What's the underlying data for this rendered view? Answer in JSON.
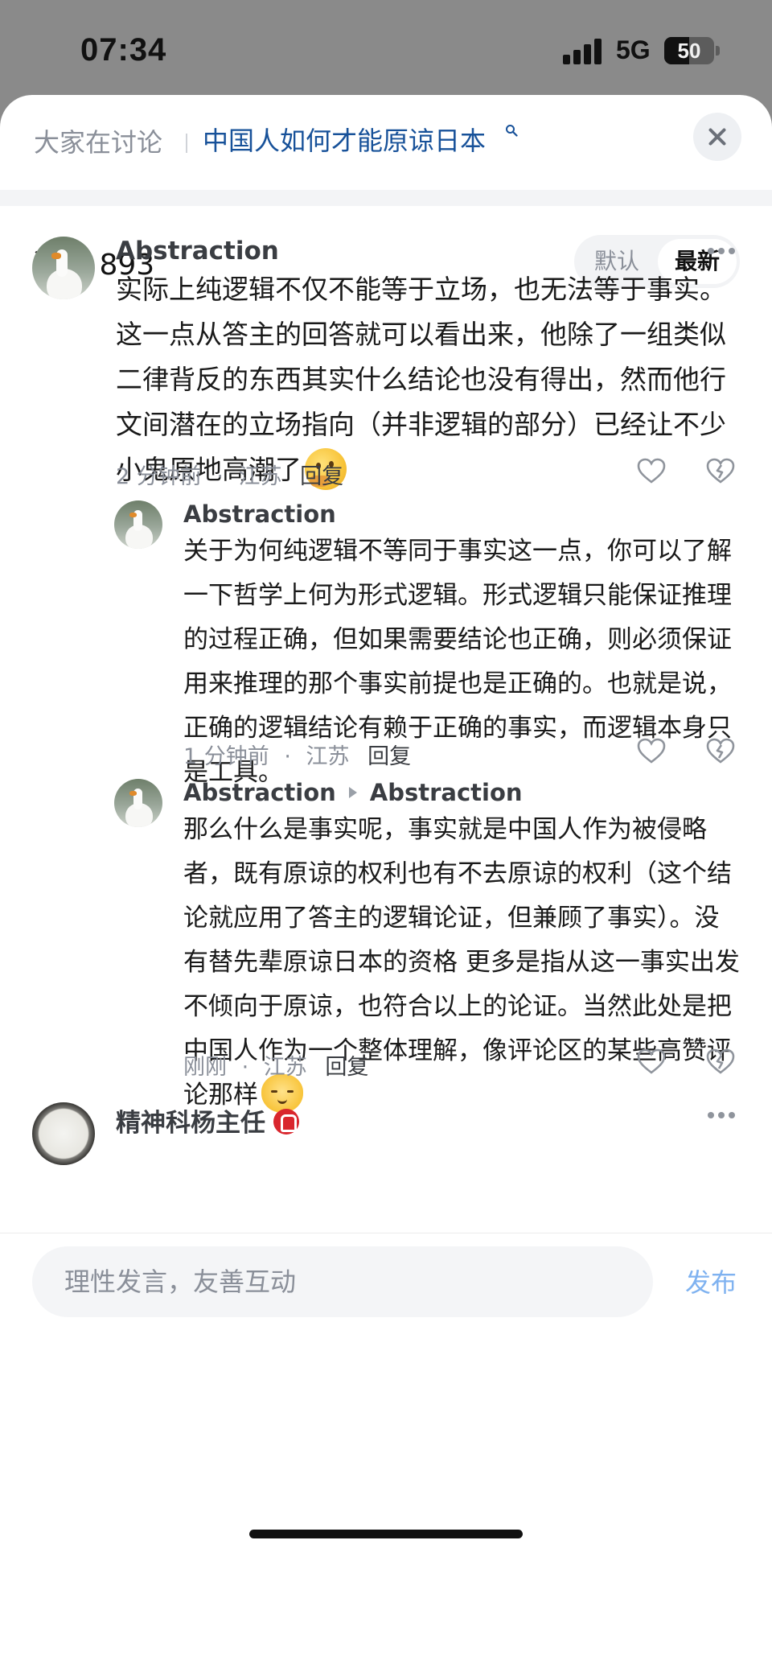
{
  "status_bar": {
    "time": "07:34",
    "network": "5G",
    "battery_level": "50"
  },
  "header": {
    "label": "大家在讨论",
    "topic": "中国人如何才能原谅日本"
  },
  "comments_header": {
    "count_label": "评论 893",
    "sort_default": "默认",
    "sort_latest": "最新"
  },
  "comments": [
    {
      "author": "Abstraction",
      "text": "实际上纯逻辑不仅不能等于立场，也无法等于事实。这一点从答主的回答就可以看出来，他除了一组类似二律背反的东西其实什么结论也没有得出，然而他行文间潜在的立场指向（并非逻辑的部分）已经让不少小鬼原地高潮了",
      "time": "2 分钟前",
      "location": "江苏",
      "reply": "回复"
    },
    {
      "author": "Abstraction",
      "text": "关于为何纯逻辑不等同于事实这一点，你可以了解一下哲学上何为形式逻辑。形式逻辑只能保证推理的过程正确，但如果需要结论也正确，则必须保证用来推理的那个事实前提也是正确的。也就是说，正确的逻辑结论有赖于正确的事实，而逻辑本身只是工具。",
      "time": "1 分钟前",
      "location": "江苏",
      "reply": "回复"
    },
    {
      "author": "Abstraction",
      "reply_to": "Abstraction",
      "text": "那么什么是事实呢，事实就是中国人作为被侵略者，既有原谅的权利也有不去原谅的权利（这个结论就应用了答主的逻辑论证，但兼顾了事实）。没有替先辈原谅日本的资格 更多是指从这一事实出发不倾向于原谅，也符合以上的论证。当然此处是把中国人作为一个整体理解，像评论区的某些高赞评论那样",
      "time": "刚刚",
      "location": "江苏",
      "reply": "回复"
    },
    {
      "author": "精神科杨主任"
    }
  ],
  "meta_separator": "·",
  "input": {
    "placeholder": "理性发言，友善互动",
    "publish_label": "发布"
  },
  "colors": {
    "topic_link": "#175199",
    "publish": "#7fb2f0",
    "badge": "#d9262d"
  },
  "icons": [
    "search-icon",
    "close-icon",
    "more-icon",
    "like-icon",
    "dislike-icon",
    "thinking-emoji-icon",
    "cat-emoji-icon",
    "badge-icon"
  ]
}
